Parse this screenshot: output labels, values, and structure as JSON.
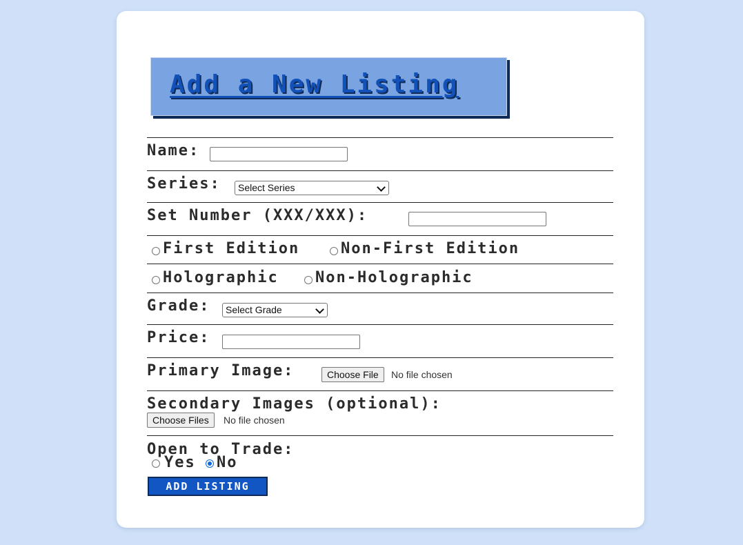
{
  "page": {
    "title": "Add a New Listing"
  },
  "form": {
    "name_label": "Name:",
    "name_value": "",
    "series_label": "Series:",
    "series_selected": "Select Series",
    "set_number_label": "Set Number (XXX/XXX):",
    "set_number_value": "",
    "edition_options": [
      "First Edition",
      "Non-First Edition"
    ],
    "holo_options": [
      "Holographic",
      "Non-Holographic"
    ],
    "grade_label": "Grade:",
    "grade_selected": "Select Grade",
    "price_label": "Price:",
    "price_value": "",
    "primary_image_label": "Primary Image:",
    "primary_button": "Choose File",
    "primary_status": "No file chosen",
    "secondary_images_label": "Secondary Images (optional):",
    "secondary_button": "Choose Files",
    "secondary_status": "No file chosen",
    "trade_label": "Open to Trade:",
    "trade_options": [
      "Yes",
      "No"
    ],
    "trade_selected": "No",
    "submit_label": "ADD LISTING"
  },
  "colors": {
    "background": "#cfe0f8",
    "title_bg": "#7aa3e1",
    "title_text": "#1251b8",
    "accent": "#1256c4",
    "shadow": "#0f2a55",
    "radio_checked": "#0b68d8"
  }
}
